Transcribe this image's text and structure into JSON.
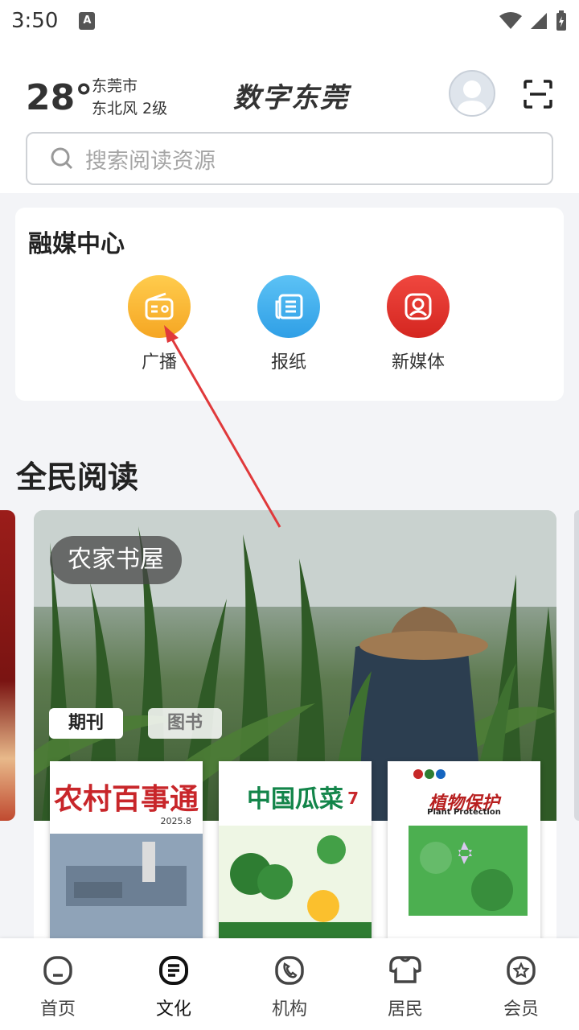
{
  "status_bar": {
    "time": "3:50",
    "notification_icon": "A"
  },
  "header": {
    "temperature": "28°",
    "city": "东莞市",
    "wind": "东北风  2级",
    "brand": "数字东莞"
  },
  "search": {
    "placeholder": "搜索阅读资源"
  },
  "media_center": {
    "title": "融媒中心",
    "items": [
      {
        "label": "广播",
        "icon": "radio-icon",
        "color": "#f5a623"
      },
      {
        "label": "报纸",
        "icon": "newspaper-icon",
        "color": "#2f9fe6"
      },
      {
        "label": "新媒体",
        "icon": "new-media-icon",
        "color": "#e0302b"
      }
    ]
  },
  "reading": {
    "title": "全民阅读",
    "banner_tag": "农家书屋",
    "tabs": [
      {
        "label": "期刊"
      },
      {
        "label": "图书"
      }
    ],
    "magazines": [
      {
        "title": "农村百事通",
        "issue": "2025.8"
      },
      {
        "title": "中国瓜菜",
        "issue": "7"
      },
      {
        "title": "植物保护",
        "subtitle": "Plant Protection"
      }
    ]
  },
  "tabbar": {
    "items": [
      {
        "label": "首页",
        "icon": "home-icon"
      },
      {
        "label": "文化",
        "icon": "culture-icon"
      },
      {
        "label": "机构",
        "icon": "institution-icon"
      },
      {
        "label": "居民",
        "icon": "resident-icon"
      },
      {
        "label": "会员",
        "icon": "member-icon"
      }
    ],
    "active": "文化"
  },
  "colors": {
    "accent_red": "#e0302b",
    "radio_orange": "#f5a623",
    "paper_blue": "#2f9fe6"
  }
}
